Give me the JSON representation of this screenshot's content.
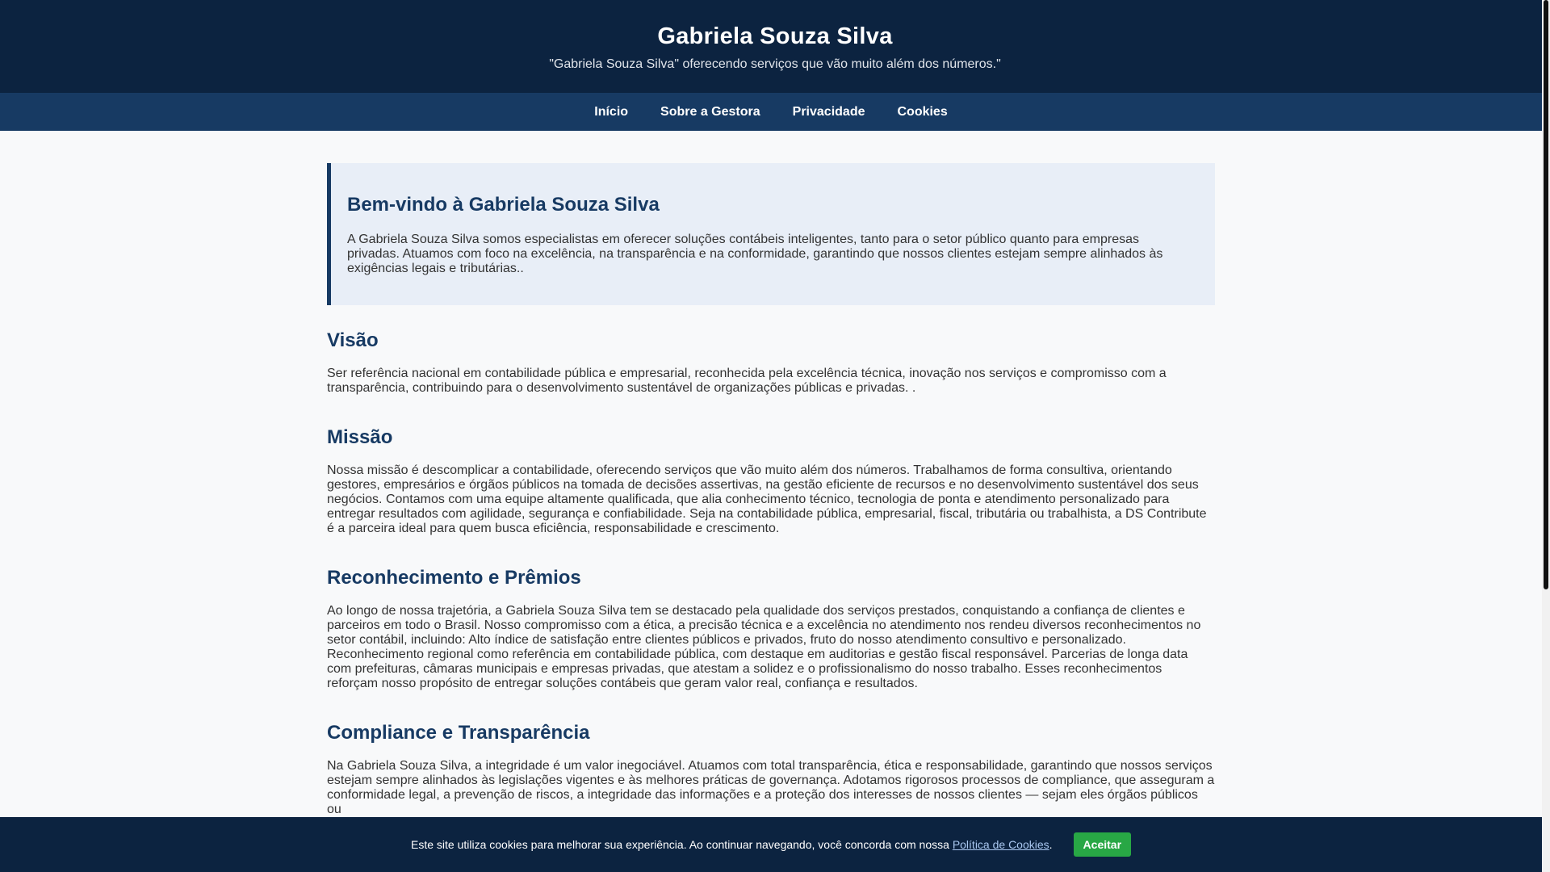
{
  "header": {
    "title": "Gabriela Souza Silva",
    "tagline": "\"Gabriela Souza Silva\" oferecendo serviços que vão muito além dos números.\""
  },
  "nav": {
    "items": [
      "Início",
      "Sobre a Gestora",
      "Privacidade",
      "Cookies"
    ]
  },
  "welcome": {
    "title": "Bem-vindo à Gabriela Souza Silva",
    "text": "A Gabriela Souza Silva somos especialistas em oferecer soluções contábeis inteligentes, tanto para o setor público quanto para empresas privadas. Atuamos com foco na excelência, na transparência e na conformidade, garantindo que nossos clientes estejam sempre alinhados às exigências legais e tributárias.."
  },
  "sections": [
    {
      "title": "Visão",
      "text": "Ser referência nacional em contabilidade pública e empresarial, reconhecida pela excelência técnica, inovação nos serviços e compromisso com a transparência, contribuindo para o desenvolvimento sustentável de organizações públicas e privadas. ."
    },
    {
      "title": "Missão",
      "text": "Nossa missão é descomplicar a contabilidade, oferecendo serviços que vão muito além dos números. Trabalhamos de forma consultiva, orientando gestores, empresários e órgãos públicos na tomada de decisões assertivas, na gestão eficiente de recursos e no desenvolvimento sustentável dos seus negócios. Contamos com uma equipe altamente qualificada, que alia conhecimento técnico, tecnologia de ponta e atendimento personalizado para entregar resultados com agilidade, segurança e confiabilidade. Seja na contabilidade pública, empresarial, fiscal, tributária ou trabalhista, a DS Contribute é a parceira ideal para quem busca eficiência, responsabilidade e crescimento."
    },
    {
      "title": "Reconhecimento e Prêmios",
      "text": "Ao longo de nossa trajetória, a Gabriela Souza Silva tem se destacado pela qualidade dos serviços prestados, conquistando a confiança de clientes e parceiros em todo o Brasil. Nosso compromisso com a ética, a precisão técnica e a excelência no atendimento nos rendeu diversos reconhecimentos no setor contábil, incluindo: Alto índice de satisfação entre clientes públicos e privados, fruto do nosso atendimento consultivo e personalizado. Reconhecimento regional como referência em contabilidade pública, com destaque em auditorias e gestão fiscal responsável. Parcerias de longa data com prefeituras, câmaras municipais e empresas privadas, que atestam a solidez e o profissionalismo do nosso trabalho. Esses reconhecimentos reforçam nosso propósito de entregar soluções contábeis que geram valor real, confiança e resultados."
    },
    {
      "title": "Compliance e Transparência",
      "text": "Na Gabriela Souza Silva, a integridade é um valor inegociável. Atuamos com total transparência, ética e responsabilidade, garantindo que nossos serviços estejam sempre alinhados às legislações vigentes e às melhores práticas de governança. Adotamos rigorosos processos de compliance, que asseguram a conformidade legal, a prevenção de riscos, a integridade das informações e a proteção dos interesses de nossos clientes — sejam eles órgãos públicos ou"
    }
  ],
  "cookie": {
    "text": "Este site utiliza cookies para melhorar sua experiência. Ao continuar navegando, você concorda com nossa ",
    "link": "Política de Cookies",
    "after": ".",
    "accept": "Aceitar"
  }
}
